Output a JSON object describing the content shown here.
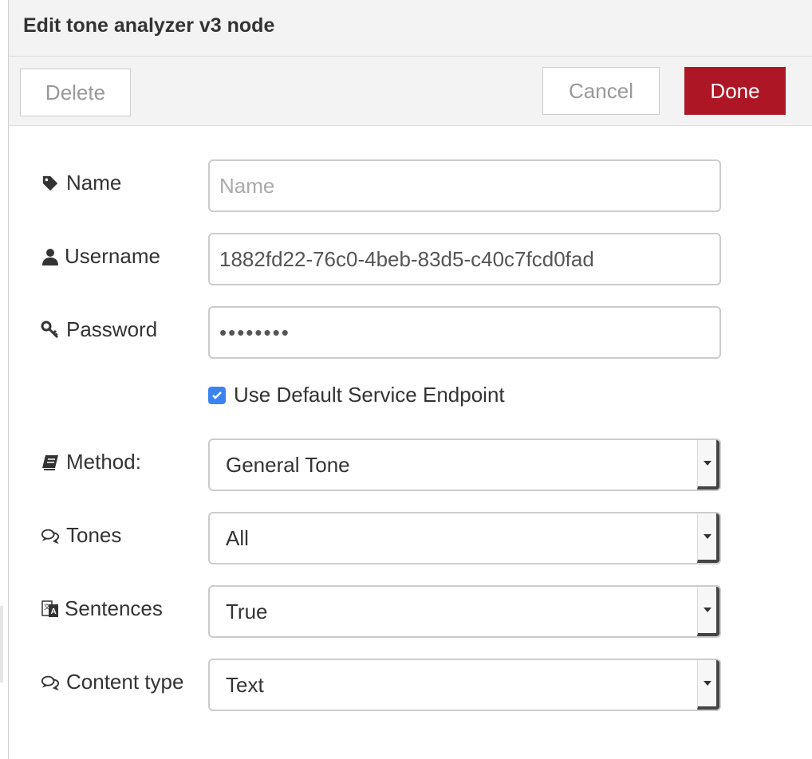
{
  "header": {
    "title": "Edit tone analyzer v3 node"
  },
  "toolbar": {
    "delete_label": "Delete",
    "cancel_label": "Cancel",
    "done_label": "Done",
    "done_color": "#ad1625"
  },
  "form": {
    "name": {
      "label": "Name",
      "value": "",
      "placeholder": "Name",
      "icon": "tag-icon"
    },
    "username": {
      "label": "Username",
      "value": "1882fd22-76c0-4beb-83d5-c40c7fcd0fad",
      "icon": "user-icon"
    },
    "password": {
      "label": "Password",
      "value": "••••••••",
      "icon": "key-icon"
    },
    "default_endpoint": {
      "label": "Use Default Service Endpoint",
      "checked": true,
      "checkbox_color": "#3b84f0"
    },
    "method": {
      "label": "Method:",
      "selected": "General Tone",
      "icon": "book-icon"
    },
    "tones": {
      "label": "Tones",
      "selected": "All",
      "icon": "comments-icon"
    },
    "sentences": {
      "label": "Sentences",
      "selected": "True",
      "icon": "translate-icon"
    },
    "content_type": {
      "label": "Content type",
      "selected": "Text",
      "icon": "comments-icon"
    }
  }
}
